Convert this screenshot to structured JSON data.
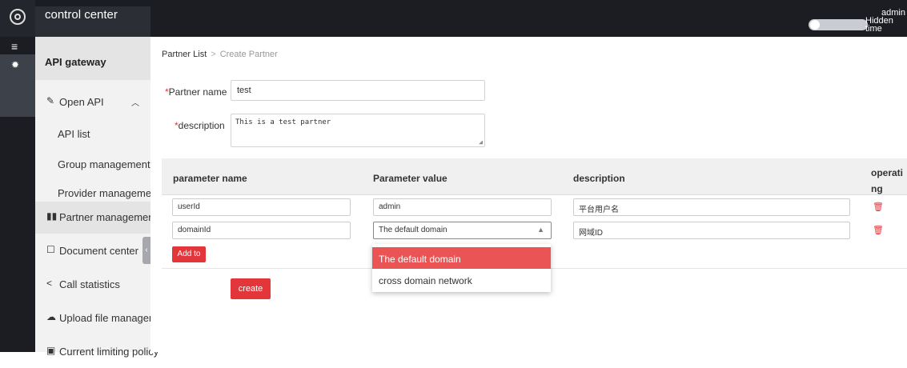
{
  "header": {
    "app_title": "control center",
    "toggle_label": "Hidden time",
    "user": "admin"
  },
  "sidebar": {
    "title": "API gateway",
    "items": [
      {
        "label": "Open API",
        "icon": "pencil-icon",
        "expanded": true
      },
      {
        "label": "API list"
      },
      {
        "label": "Group management"
      },
      {
        "label": "Provider management"
      },
      {
        "label": "Partner management",
        "icon": "partner-icon",
        "active": true
      },
      {
        "label": "Document center",
        "icon": "document-icon"
      },
      {
        "label": "Call statistics",
        "icon": "share-icon"
      },
      {
        "label": "Upload file manageme",
        "icon": "cloud-upload-icon"
      },
      {
        "label": "Current limiting policy",
        "icon": "policy-icon"
      }
    ]
  },
  "breadcrumb": {
    "parent": "Partner List",
    "separator": ">",
    "current": "Create Partner"
  },
  "form": {
    "required_mark": "*",
    "partner_name_label": "Partner name",
    "partner_name_value": "test",
    "description_label": "description",
    "description_value": "This is a test partner"
  },
  "table": {
    "headers": [
      "parameter name",
      "Parameter value",
      "description",
      "operati\nng"
    ],
    "rows": [
      {
        "name": "userId",
        "value": "admin",
        "description": "平台用户名"
      },
      {
        "name": "domainId",
        "value": "The default domain",
        "description": "网域ID"
      }
    ],
    "add_button": "Add to"
  },
  "dropdown": {
    "options": [
      "The default domain",
      "cross domain network"
    ],
    "selected": "The default domain"
  },
  "create_button": "create",
  "colors": {
    "accent": "#e2363b",
    "dropdown_selected": "#ea5455",
    "topbar": "#1b1d22"
  }
}
